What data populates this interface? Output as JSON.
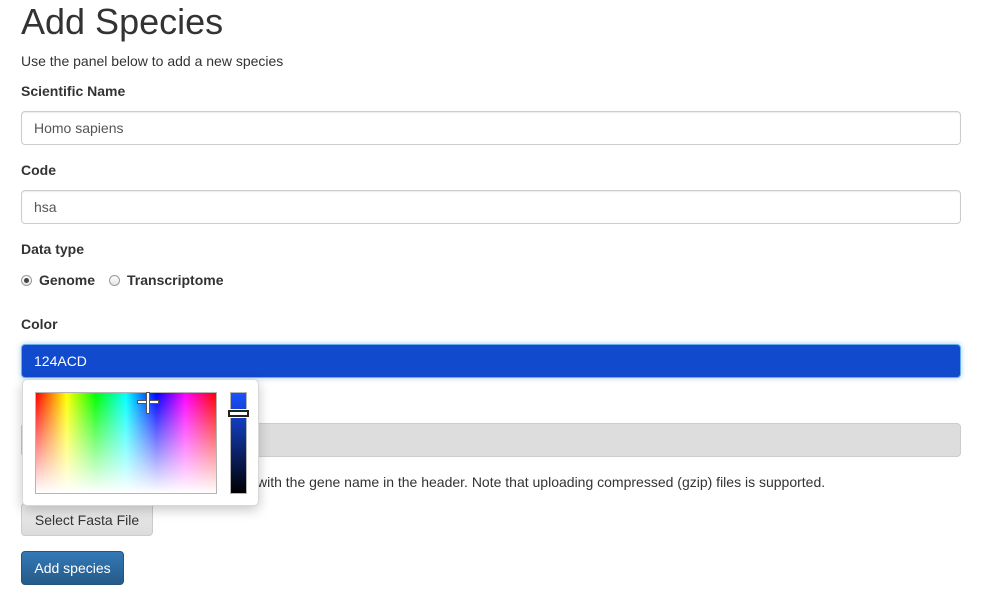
{
  "page": {
    "title": "Add Species",
    "subtitle": "Use the panel below to add a new species"
  },
  "form": {
    "scientific_name": {
      "label": "Scientific Name",
      "value": "Homo sapiens"
    },
    "code": {
      "label": "Code",
      "value": "hsa"
    },
    "data_type": {
      "label": "Data type",
      "options": [
        {
          "label": "Genome",
          "selected": true
        },
        {
          "label": "Transcriptome",
          "selected": false
        }
      ]
    },
    "color": {
      "label": "Color",
      "value": "124ACD",
      "hex": "#124ACD"
    },
    "file": {
      "help_text": "with the gene name in the header. Note that uploading compressed (gzip) files is supported.",
      "button_label": "Select Fasta File"
    },
    "submit_label": "Add species"
  },
  "color_picker": {
    "open": true
  },
  "colors": {
    "primary": "#337ab7",
    "focus": "#66afe9"
  }
}
